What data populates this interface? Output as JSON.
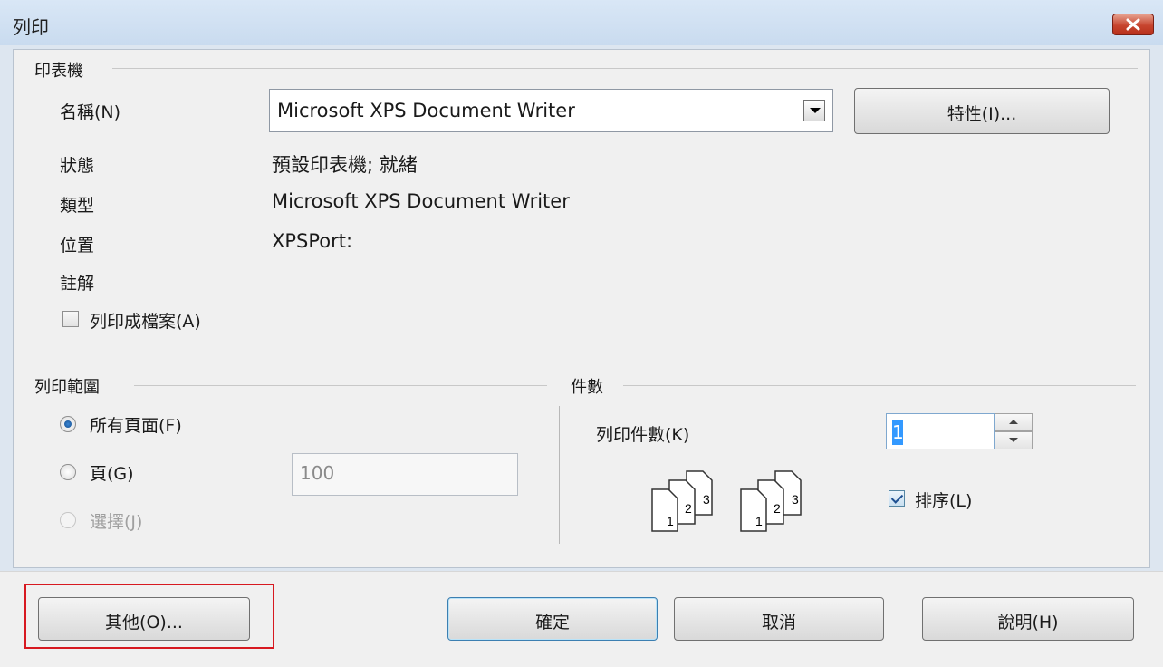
{
  "window": {
    "title": "列印"
  },
  "printer": {
    "group_label": "印表機",
    "name_label": "名稱(N)",
    "name_value": "Microsoft XPS Document Writer",
    "properties_button": "特性(I)...",
    "status_label": "狀態",
    "status_value": "預設印表機; 就緒",
    "type_label": "類型",
    "type_value": "Microsoft XPS Document Writer",
    "location_label": "位置",
    "location_value": "XPSPort:",
    "comment_label": "註解",
    "print_to_file_label": "列印成檔案(A)",
    "print_to_file_checked": false
  },
  "print_range": {
    "group_label": "列印範圍",
    "all_pages_label": "所有頁面(F)",
    "pages_label": "頁(G)",
    "pages_value": "100",
    "selection_label": "選擇(J)",
    "selected_option": "all_pages"
  },
  "copies": {
    "group_label": "件數",
    "count_label": "列印件數(K)",
    "count_value": "1",
    "collate_label": "排序(L)",
    "collate_checked": true,
    "collate_page_numbers": [
      "1",
      "2",
      "3"
    ]
  },
  "buttons": {
    "other": "其他(O)...",
    "ok": "確定",
    "cancel": "取消",
    "help": "說明(H)"
  },
  "colors": {
    "highlight": "#d71920",
    "close_button": "#c7452f",
    "selection": "#3399ff"
  }
}
